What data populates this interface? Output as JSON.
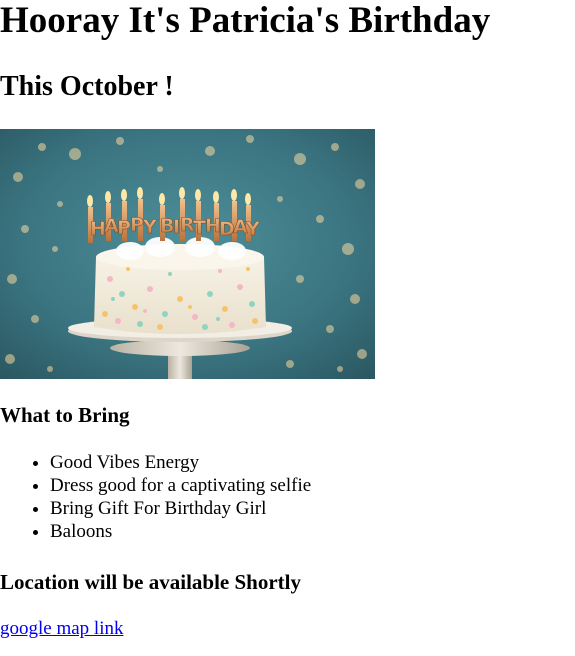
{
  "header": {
    "title": "Hooray It's Patricia's Birthday",
    "subtitle": "This October !"
  },
  "hero_image": {
    "description_icon": "birthday-cake-image",
    "banner_letters": [
      "H",
      "A",
      "P",
      "P",
      "Y",
      "B",
      "I",
      "R",
      "T",
      "H",
      "D",
      "A",
      "Y"
    ],
    "colors": {
      "background": "#3f7d8a",
      "cake": "#f4efe3",
      "gold": "#d9955a"
    }
  },
  "bring": {
    "heading": "What to Bring",
    "items": [
      "Good Vibes Energy",
      "Dress good for a captivating selfie",
      "Bring Gift For Birthday Girl",
      "Baloons"
    ]
  },
  "location": {
    "heading": "Location will be available Shortly",
    "link_text": "google map link",
    "link_color": "#0000ee"
  }
}
